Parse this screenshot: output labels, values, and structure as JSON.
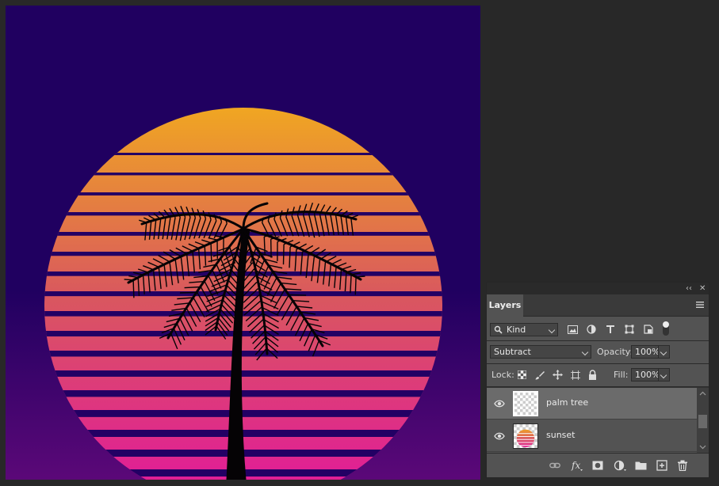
{
  "colors": {
    "canvas_top": "#200060",
    "canvas_bottom": "#5b0878",
    "sun_top": "#f0a622",
    "sun_mid": "#d9575f",
    "sun_bottom": "#e11c98",
    "panel_bg": "#535353"
  },
  "panel": {
    "collapse_label": "‹‹",
    "close_label": "✕",
    "tab_label": "Layers",
    "menu_icon": "panel-menu-icon",
    "filter": {
      "search_icon": "search-icon",
      "value": "Kind",
      "filter_icons": [
        "image-filter-icon",
        "adjustment-filter-icon",
        "type-filter-icon",
        "shape-filter-icon",
        "smart-object-filter-icon",
        "filter-toggle-icon"
      ]
    },
    "blend_mode": "Subtract",
    "opacity_label": "Opacity:",
    "opacity_value": "100%",
    "lock_label": "Lock:",
    "lock_icons": [
      "lock-transparent-icon",
      "lock-paint-icon",
      "lock-position-icon",
      "lock-artboard-icon",
      "lock-all-icon"
    ],
    "fill_label": "Fill:",
    "fill_value": "100%",
    "layers": [
      {
        "name": "palm tree",
        "visible": true,
        "selected": true,
        "thumbnail": "transparent"
      },
      {
        "name": "sunset",
        "visible": true,
        "selected": false,
        "thumbnail": "sunset"
      }
    ],
    "bottom_icons": [
      "link-layers-icon",
      "fx-icon",
      "layer-mask-icon",
      "adjustment-layer-icon",
      "group-folder-icon",
      "new-layer-icon",
      "trash-icon"
    ]
  }
}
